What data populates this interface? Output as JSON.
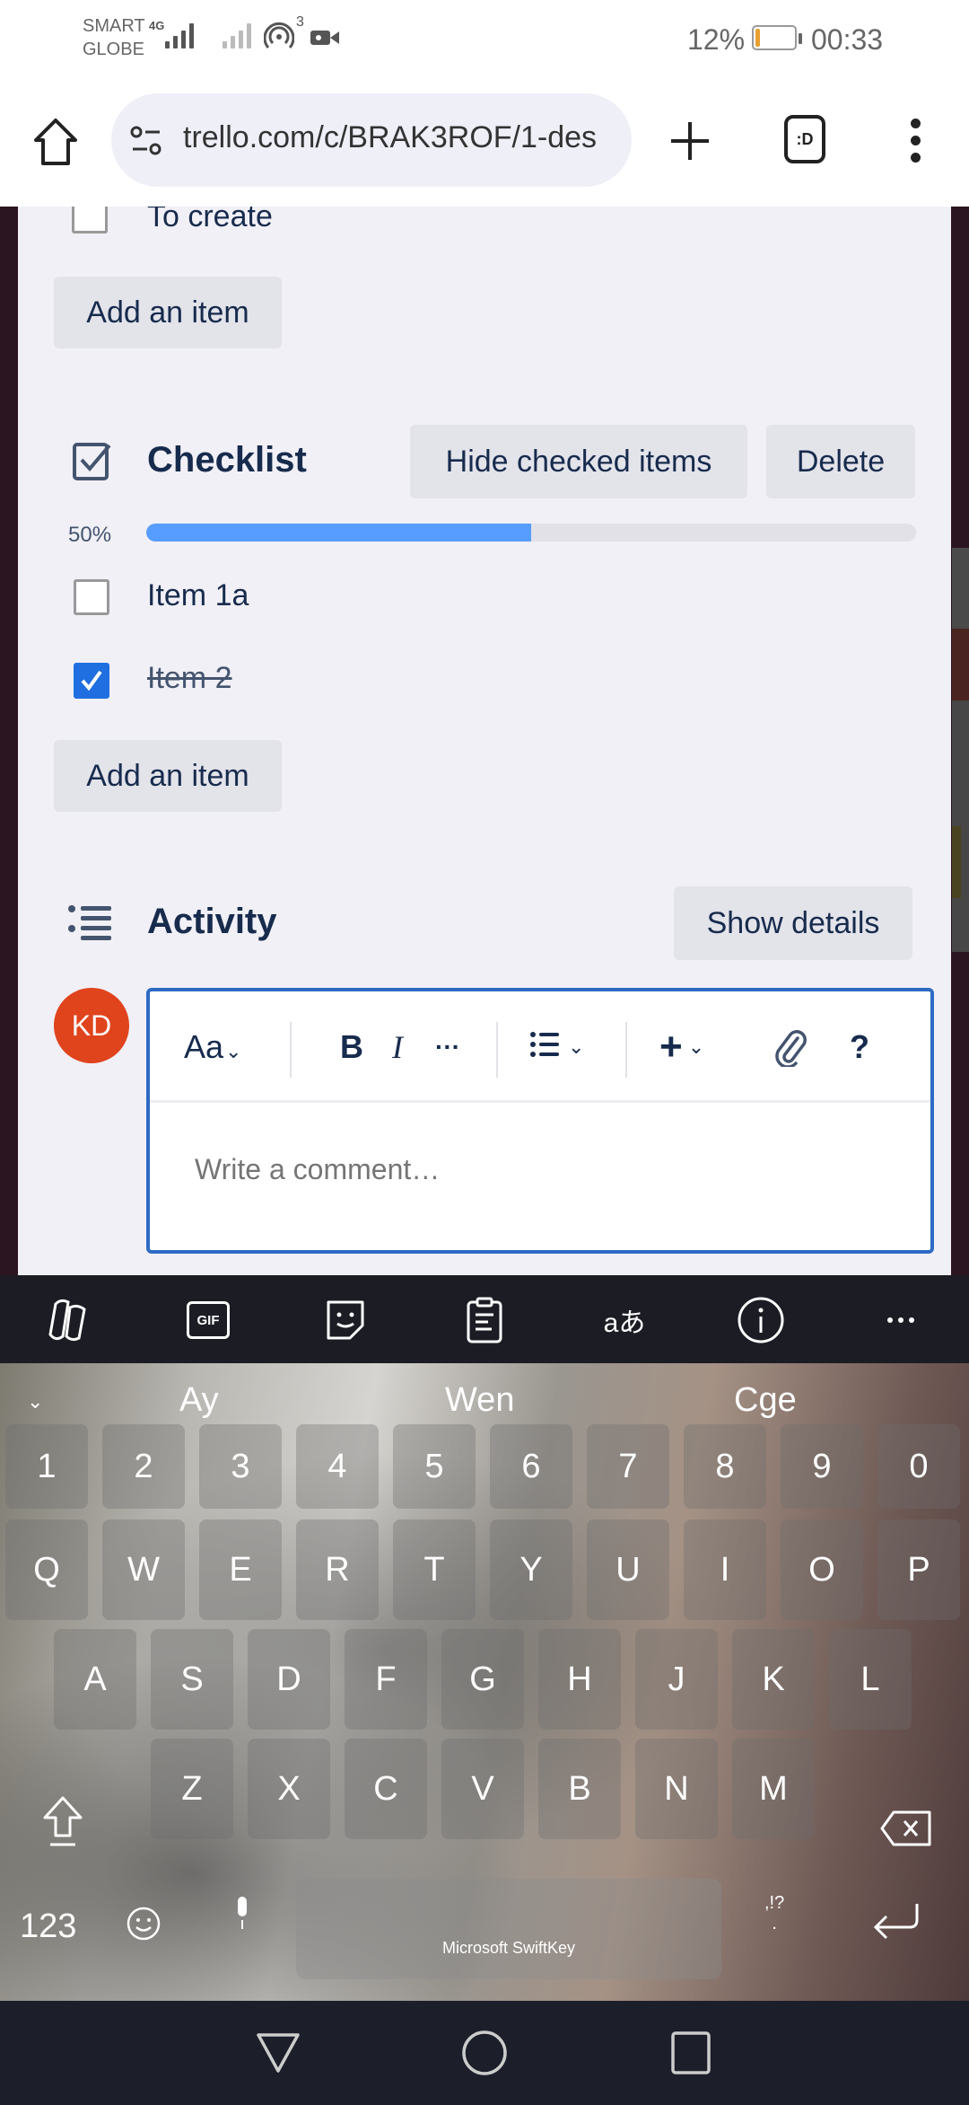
{
  "status_bar": {
    "carrier_line1": "SMART",
    "carrier_line2": "GLOBE",
    "network": "4G",
    "hotspot_count": "3",
    "battery_percent": "12%",
    "battery_level": 0.12,
    "time": "00:33",
    "colors": {
      "battery_fill": "#e9a033"
    }
  },
  "browser": {
    "url": "trello.com/c/BRAK3ROF/1-des",
    "icons": [
      "home-icon",
      "tune-icon",
      "plus-icon",
      "tab-switcher-icon",
      "more-vert-icon"
    ],
    "tab_count_label": ":D"
  },
  "card": {
    "previous_checklist": {
      "items": [
        {
          "label": "To create",
          "checked": false
        }
      ],
      "add_item_label": "Add an item"
    },
    "checklist": {
      "title": "Checklist",
      "hide_checked_label": "Hide checked items",
      "delete_label": "Delete",
      "progress_label": "50%",
      "progress": 0.5,
      "items": [
        {
          "label": "Item 1a",
          "checked": false
        },
        {
          "label": "Item 2",
          "checked": true
        }
      ],
      "add_item_label": "Add an item"
    },
    "activity": {
      "title": "Activity",
      "show_details_label": "Show details",
      "avatar_initials": "KD",
      "editor": {
        "toolbar": {
          "text_style": "Aa",
          "bold": "B",
          "italic": "I",
          "more": "···",
          "help": "?"
        },
        "placeholder": "Write a comment…",
        "value": ""
      }
    },
    "colors": {
      "accent": "#1f6fe0",
      "progress": "#579dff",
      "avatar": "#e0441d",
      "editor_border": "#2e6ac4"
    }
  },
  "keyboard": {
    "toolbar_icons": [
      "copilot-icon",
      "gif-icon",
      "sticker-icon",
      "clipboard-icon",
      "translate-icon",
      "info-icon",
      "more-horiz-icon"
    ],
    "gif_label": "GIF",
    "translate_label": "aあ",
    "suggestions": [
      "Ay",
      "Wen",
      "Cge"
    ],
    "rows": {
      "numbers": [
        "1",
        "2",
        "3",
        "4",
        "5",
        "6",
        "7",
        "8",
        "9",
        "0"
      ],
      "row1": [
        "Q",
        "W",
        "E",
        "R",
        "T",
        "Y",
        "U",
        "I",
        "O",
        "P"
      ],
      "row2": [
        "A",
        "S",
        "D",
        "F",
        "G",
        "H",
        "J",
        "K",
        "L"
      ],
      "row3": [
        "Z",
        "X",
        "C",
        "V",
        "B",
        "N",
        "M"
      ]
    },
    "symbols_label": "123",
    "punct_label": ",!?",
    "period_label": ".",
    "space_label": "Microsoft SwiftKey"
  },
  "nav_bar": {
    "buttons": [
      "back",
      "home",
      "recents"
    ]
  }
}
